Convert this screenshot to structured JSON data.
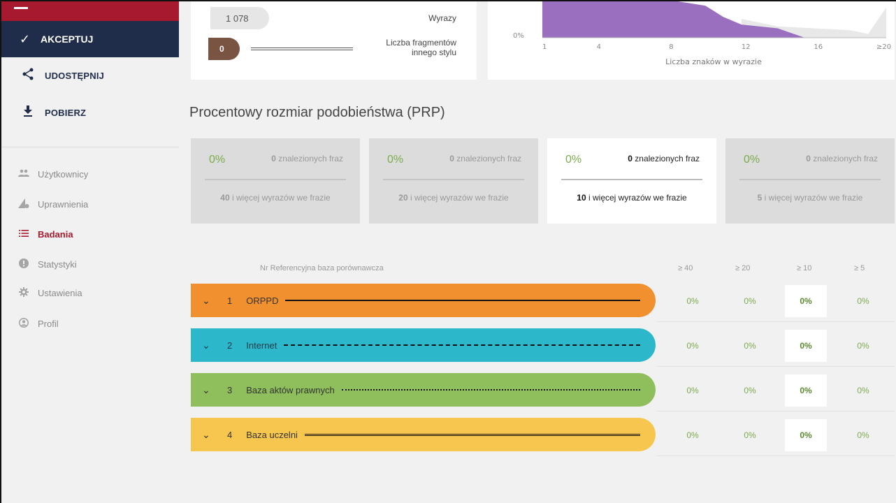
{
  "sidebar": {
    "accept_label": "AKCEPTUJ",
    "share_label": "UDOSTĘPNIJ",
    "download_label": "POBIERZ",
    "nav": [
      {
        "label": "Użytkownicy",
        "icon": "users-icon",
        "active": false
      },
      {
        "label": "Uprawnienia",
        "icon": "permissions-icon",
        "active": false
      },
      {
        "label": "Badania",
        "icon": "list-icon",
        "active": true
      },
      {
        "label": "Statystyki",
        "icon": "alert-circle-icon",
        "active": false
      },
      {
        "label": "Ustawienia",
        "icon": "gear-icon",
        "active": false
      },
      {
        "label": "Profil",
        "icon": "user-circle-icon",
        "active": false
      }
    ]
  },
  "stats": {
    "words_value": "1 078",
    "words_label": "Wyrazy",
    "other_style_value": "0",
    "other_style_label_1": "Liczba fragmentów",
    "other_style_label_2": "innego stylu"
  },
  "chart_data": {
    "type": "area",
    "xlabel": "Liczba znaków w wyrazie",
    "x_ticks": [
      "1",
      "4",
      "8",
      "12",
      "16",
      "≥20"
    ],
    "y_ticks": [
      "0%"
    ],
    "series": [
      {
        "name": "",
        "color": "#9b6fc0",
        "x": [
          1,
          4,
          8,
          10,
          11,
          12,
          14,
          15.5
        ],
        "values": [
          1,
          1,
          1,
          0.85,
          0.55,
          0.35,
          0.25,
          0
        ]
      },
      {
        "name": "",
        "color": "#e8e8e8",
        "x": [
          12,
          14,
          16,
          18,
          19,
          20
        ],
        "values": [
          0.5,
          0.3,
          0.25,
          0.2,
          0.1,
          0.8
        ]
      }
    ]
  },
  "prp": {
    "title": "Procentowy rozmiar podobieństwa (PRP)",
    "boxes": [
      {
        "pct": "0%",
        "found_num": "0",
        "found_text": " znalezionych fraz",
        "words_num": "40",
        "words_text": " i więcej wyrazów we frazie",
        "active": false
      },
      {
        "pct": "0%",
        "found_num": "0",
        "found_text": " znalezionych fraz",
        "words_num": "20",
        "words_text": " i więcej wyrazów we frazie",
        "active": false
      },
      {
        "pct": "0%",
        "found_num": "0",
        "found_text": " znalezionych fraz",
        "words_num": "10",
        "words_text": " i więcej wyrazów we frazie",
        "active": true
      },
      {
        "pct": "0%",
        "found_num": "0",
        "found_text": " znalezionych fraz",
        "words_num": "5",
        "words_text": " i więcej wyrazów we frazie",
        "active": false
      }
    ]
  },
  "table": {
    "header_ref": "Nr Referencyjna baza porównawcza",
    "columns": [
      "≥ 40",
      "≥ 20",
      "≥ 10",
      "≥ 5"
    ],
    "rows": [
      {
        "nr": "1",
        "name": "ORPPD",
        "color": "#f0902f",
        "line": "solid",
        "values": [
          "0%",
          "0%",
          "0%",
          "0%"
        ]
      },
      {
        "nr": "2",
        "name": "Internet",
        "color": "#2db7cb",
        "line": "dashed",
        "values": [
          "0%",
          "0%",
          "0%",
          "0%"
        ]
      },
      {
        "nr": "3",
        "name": "Baza aktów prawnych",
        "color": "#8fbe5c",
        "line": "dotted",
        "values": [
          "0%",
          "0%",
          "0%",
          "0%"
        ]
      },
      {
        "nr": "4",
        "name": "Baza uczelni",
        "color": "#f6c64f",
        "line": "double",
        "values": [
          "0%",
          "0%",
          "0%",
          "0%"
        ]
      }
    ]
  }
}
